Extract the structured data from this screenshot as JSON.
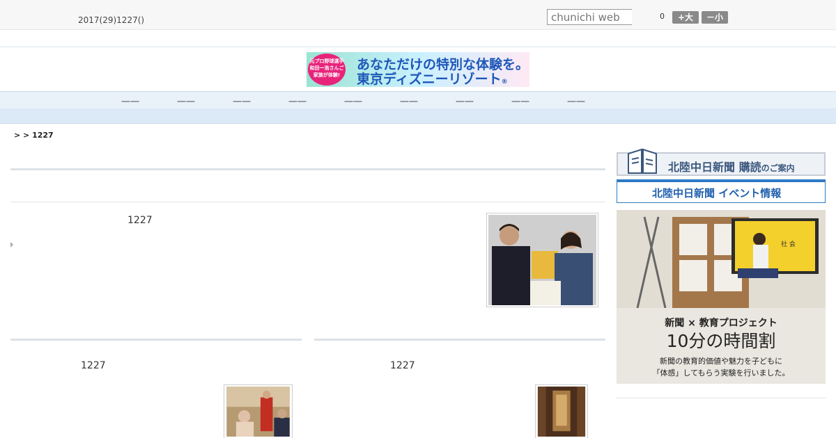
{
  "header": {
    "date": "2017(29)1227()",
    "search_placeholder": "chunichi web",
    "counter": "0",
    "font_bigger": "+大",
    "font_smaller": "－小"
  },
  "ad_banner": {
    "badge": "元プロ野球選手和田一浩さんご家族が体験!",
    "line1": "あなただけの特別な体験を。",
    "line2": "東京ディズニーリゾート",
    "mark": "®"
  },
  "global_nav": [
    "一一",
    "一一",
    "一一",
    "一一",
    "一一",
    "一一",
    "一一",
    "一一",
    "一一"
  ],
  "breadcrumb": ">  > 1227",
  "articles": {
    "main_date": "1227",
    "left_date": "1227",
    "right_date": "1227"
  },
  "sidebar": {
    "subscribe": {
      "title": "北陸中日新聞 購読",
      "suffix": "のご案内"
    },
    "event": {
      "title": "北陸中日新聞 イベント情報"
    },
    "edu": {
      "line1": "新聞 × 教育プロジェクト",
      "line2": "10分の時間割",
      "line3": "新聞の教育的価値や魅力を子どもに",
      "line4": "「体感」してもらう実験を行いました。",
      "screen_label": "社 会"
    }
  },
  "colors": {
    "nav_bg": "#e9f1f9",
    "link_blue": "#1f5fae",
    "accent_pink": "#e8237a"
  }
}
